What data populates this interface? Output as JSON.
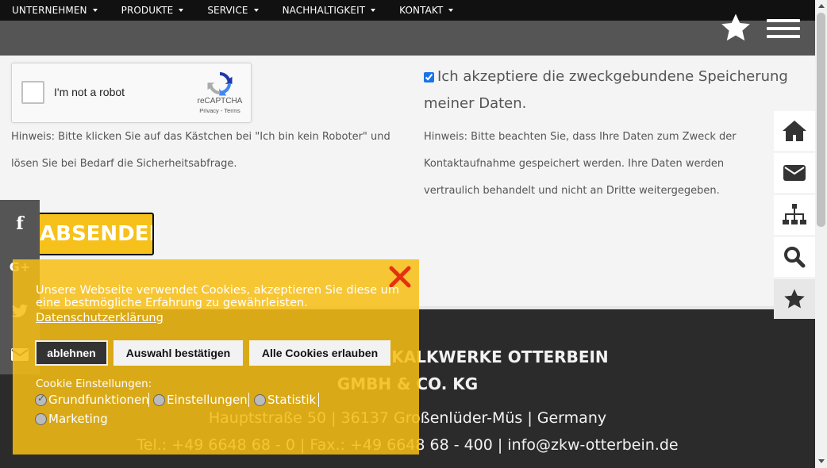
{
  "nav": {
    "items": [
      {
        "label": "UNTERNEHMEN"
      },
      {
        "label": "PRODUKTE"
      },
      {
        "label": "SERVICE"
      },
      {
        "label": "NACHHALTIGKEIT"
      },
      {
        "label": "KONTAKT"
      }
    ]
  },
  "recaptcha": {
    "label": "I'm not a robot",
    "brand": "reCAPTCHA",
    "terms": "Privacy - Terms"
  },
  "form": {
    "hint_left": "Hinweis: Bitte klicken Sie auf das Kästchen bei \"Ich bin kein Roboter\" und lösen Sie bei Bedarf die Sicherheitsabfrage.",
    "consent_label": "Ich akzeptiere die zweckgebundene Speicherung meiner Daten.",
    "consent_checked": true,
    "hint_right": "Hinweis: Bitte beachten Sie, dass Ihre Daten zum Zweck der Kontaktaufnahme gespeichert werden. Ihre Daten werden vertraulich behandelt und nicht an Dritte weitergegeben.",
    "submit_label": "ABSENDEN"
  },
  "footer": {
    "company_line1": "ZEMENT- UND KALKWERKE OTTERBEIN",
    "company_line2": "GMBH & CO. KG",
    "address": "Hauptstraße 50 | 36137 Großenlüder-Müs | Germany",
    "contact": "Tel.: +49 6648 68 - 0 | Fax.: +49 6648 68 - 400 | info@zkw-otterbein.de"
  },
  "social": {
    "facebook": "f",
    "googleplus": "G+"
  },
  "cookie": {
    "message": "Unsere Webseite verwendet Cookies, akzeptieren Sie diese um eine bestmögliche Erfahrung zu gewährleisten.",
    "policy_link": "Datenschutzerklärung",
    "decline_label": "ablehnen",
    "confirm_label": "Auswahl bestätigen",
    "accept_all_label": "Alle Cookies erlauben",
    "settings_label": "Cookie Einstellungen:",
    "options": [
      {
        "label": "Grundfunktionen",
        "checked": true
      },
      {
        "label": "Einstellungen",
        "checked": false
      },
      {
        "label": "Statistik",
        "checked": false
      },
      {
        "label": "Marketing",
        "checked": false
      }
    ]
  },
  "colors": {
    "accent": "#f6c11b",
    "nav_bg": "#111111",
    "footer_bg": "#2b2b2b"
  },
  "icons": [
    "star-icon",
    "menu-icon",
    "home-icon",
    "mail-icon",
    "sitemap-icon",
    "search-icon",
    "facebook-icon",
    "googleplus-icon",
    "twitter-icon",
    "close-icon"
  ]
}
